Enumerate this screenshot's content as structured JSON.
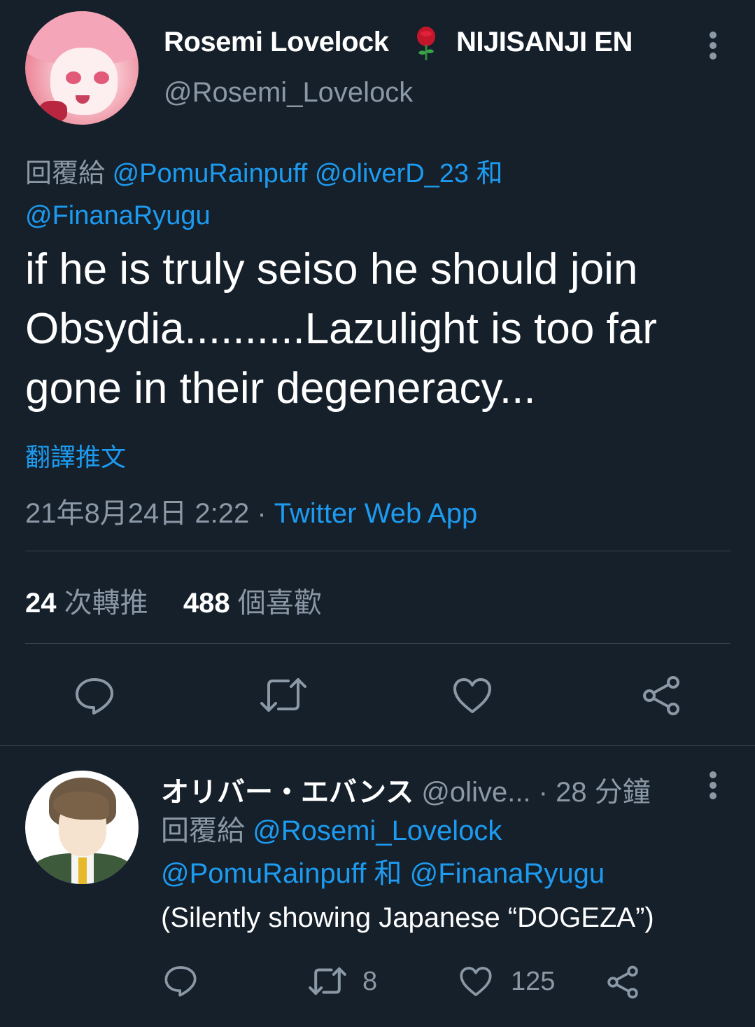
{
  "main_tweet": {
    "author": {
      "display_name": "Rosemi Lovelock",
      "org": "NIJISANJI EN",
      "handle": "@Rosemi_Lovelock"
    },
    "reply_prefix": "回覆給",
    "reply_mentions": [
      "@PomuRainpuff",
      "@oliverD_23",
      "@FinanaRyugu"
    ],
    "reply_joiner": "和",
    "text": "if he is truly seiso he should join Obsydia..........Lazulight is too far gone in their degeneracy...",
    "translate_label": "翻譯推文",
    "timestamp": "21年8月24日 2:22",
    "separator": "·",
    "source": "Twitter Web App",
    "stats": {
      "retweets_count": "24",
      "retweets_label": "次轉推",
      "likes_count": "488",
      "likes_label": "個喜歡"
    }
  },
  "reply_tweet": {
    "display_name": "オリバー・エバンス",
    "handle": "@olive...",
    "separator": "·",
    "time_ago": "28 分鐘",
    "reply_prefix": "回覆給",
    "reply_mentions": [
      "@Rosemi_Lovelock",
      "@PomuRainpuff",
      "@FinanaRyugu"
    ],
    "reply_joiner": "和",
    "text": "(Silently showing Japanese “DOGEZA”)",
    "retweet_count": "8",
    "like_count": "125"
  },
  "colors": {
    "background": "#15202b",
    "text_primary": "#ffffff",
    "text_secondary": "#8b98a5",
    "accent": "#1d9bf0",
    "divider": "#38444d"
  },
  "icons": {
    "rose": "rose-emoji-icon",
    "more": "more-vertical-icon",
    "reply": "reply-icon",
    "retweet": "retweet-icon",
    "like": "heart-icon",
    "share": "share-icon"
  }
}
